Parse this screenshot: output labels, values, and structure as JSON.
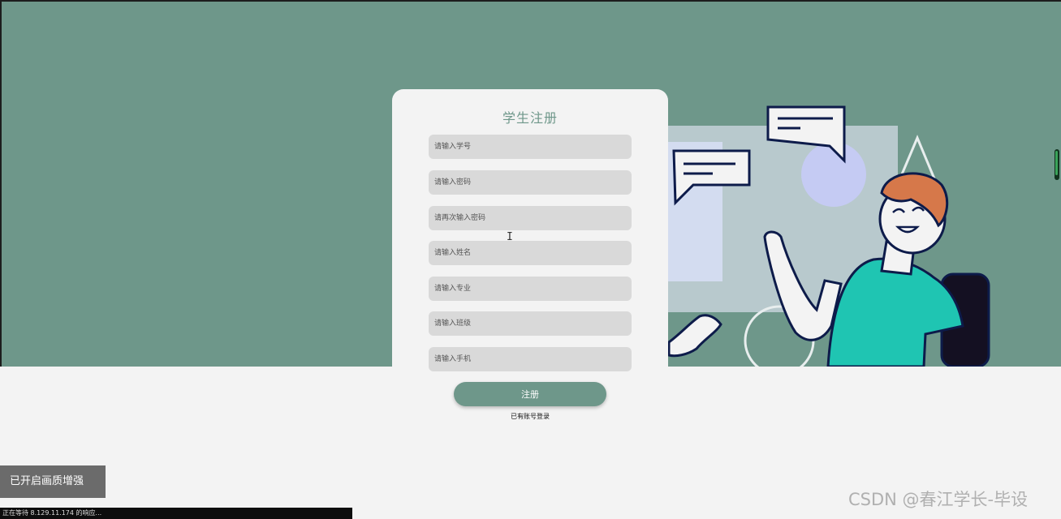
{
  "register_form": {
    "title": "学生注册",
    "fields": [
      {
        "placeholder": "请输入学号"
      },
      {
        "placeholder": "请输入密码"
      },
      {
        "placeholder": "请再次输入密码"
      },
      {
        "placeholder": "请输入姓名"
      },
      {
        "placeholder": "请输入专业"
      },
      {
        "placeholder": "请输入班级"
      },
      {
        "placeholder": "请输入手机"
      }
    ],
    "submit_label": "注册",
    "login_link": "已有账号登录"
  },
  "overlay": {
    "toast": "已开启画质增强",
    "status": "正在等待 8.129.11.174 的响应...",
    "watermark": "CSDN @春江学长-毕设"
  },
  "colors": {
    "brand": "#6e978a",
    "field_bg": "#d9d9d9",
    "page_bg": "#f3f3f3",
    "shirt": "#1fc5b2",
    "hair": "#d6784a"
  },
  "icons": [
    "text-cursor-icon"
  ]
}
